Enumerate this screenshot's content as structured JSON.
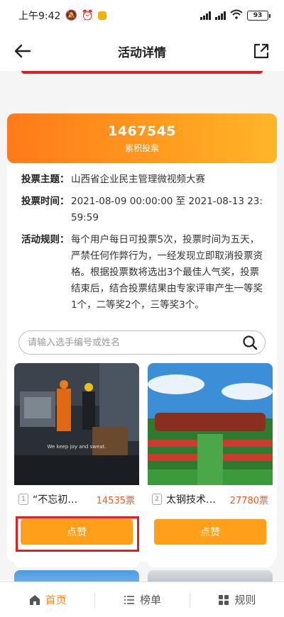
{
  "status_bar": {
    "time": "上午9:42",
    "battery": "93"
  },
  "nav": {
    "title": "活动详情"
  },
  "summary": {
    "total_votes": "1467545",
    "total_votes_label": "累积投票"
  },
  "info": {
    "theme_label": "投票主题：",
    "theme_value": "山西省企业民主管理微视频大赛",
    "time_label": "投票时间：",
    "time_value": "2021-08-09 00:00:00 至 2021-08-13 23:59:59",
    "rules_label": "活动规则：",
    "rules_value": "每个用户每日可投票5次，投票时间为五天，严禁任何作弊行为，一经发现立即取消投票资格。根据投票数将选出3个最佳人气奖，投票结束后，结合投票结果由专家评审产生一等奖1个，二等奖2个，三等奖3个。"
  },
  "search": {
    "placeholder": "请输入选手编号或姓名"
  },
  "entries": [
    {
      "index": "1",
      "name": "“不忘初…",
      "votes": "14535票",
      "button": "点赞",
      "caption": "We keep joy and sweat."
    },
    {
      "index": "2",
      "name": "太钢技术…",
      "votes": "27780票",
      "button": "点赞"
    }
  ],
  "tabs": [
    {
      "label": "首页",
      "icon": "home-icon"
    },
    {
      "label": "榜单",
      "icon": "list-icon"
    },
    {
      "label": "规则",
      "icon": "grid-icon"
    }
  ],
  "colors": {
    "accent": "#ff9f1a",
    "votes": "#e95b1f",
    "highlight": "#e02020"
  }
}
